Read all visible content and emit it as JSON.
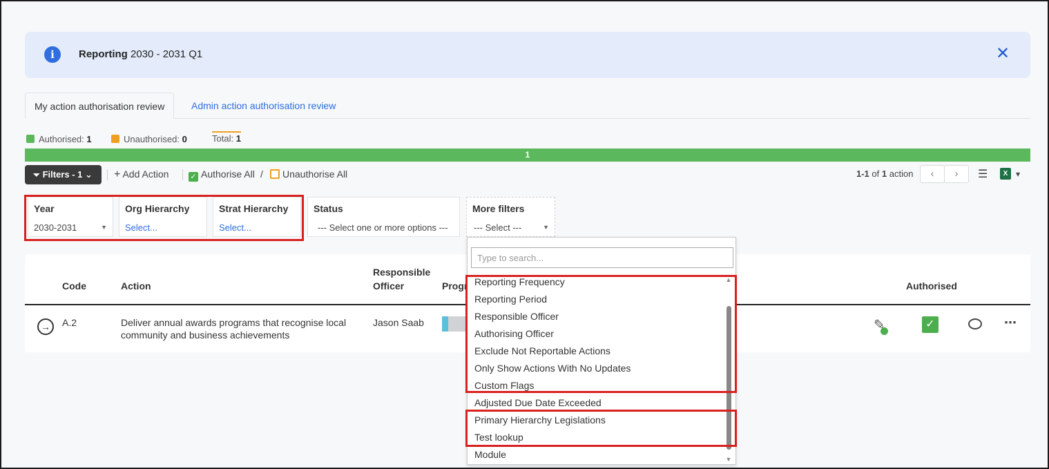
{
  "banner": {
    "title_bold": "Reporting",
    "title_rest": " 2030 - 2031 Q1",
    "info_icon": "i",
    "close_icon": "✕"
  },
  "tabs": [
    {
      "label": "My action authorisation review",
      "active": true
    },
    {
      "label": "Admin action authorisation review",
      "active": false
    }
  ],
  "legend": {
    "authorised_label": "Authorised:",
    "authorised_count": "1",
    "unauthorised_label": "Unauthorised:",
    "unauthorised_count": "0",
    "total_label": "Total:",
    "total_count": "1",
    "colors": {
      "authorised": "#5cb85c",
      "unauthorised": "#f0a020"
    }
  },
  "progress": {
    "label": "1",
    "fraction_authorised": 1.0
  },
  "toolbar": {
    "filters_label": "Filters - 1",
    "filters_caret": "⌄",
    "add_action_label": "Add Action",
    "authorise_all_label": "Authorise All",
    "slash": "/",
    "unauthorise_all_label": "Unauthorise All",
    "pager_range": "1-1",
    "pager_of": "of",
    "pager_total": "1",
    "pager_unit": "action",
    "prev": "‹",
    "next": "›",
    "settings_icon": "sliders-icon",
    "excel_icon": "excel-icon",
    "excel_text": "X",
    "export_caret": "▾"
  },
  "filters": {
    "year": {
      "label": "Year",
      "value": "2030-2031"
    },
    "org": {
      "label": "Org Hierarchy",
      "placeholder": "Select..."
    },
    "strat": {
      "label": "Strat Hierarchy",
      "placeholder": "Select..."
    },
    "status": {
      "label": "Status",
      "placeholder": "--- Select one or more options ---"
    },
    "more": {
      "label": "More filters",
      "placeholder": "--- Select ---"
    }
  },
  "table": {
    "headers": {
      "code": "Code",
      "action": "Action",
      "officer_line1": "Responsible",
      "officer_line2": "Officer",
      "progress": "Progr",
      "authorised": "Authorised"
    },
    "rows": [
      {
        "code": "A.2",
        "action_line1": "Deliver annual awards programs that recognise local",
        "action_line2": "community and business achievements",
        "officer": "Jason Saab",
        "progress_fraction": 0.25,
        "authorised": true
      }
    ]
  },
  "dropdown": {
    "search_placeholder": "Type to search...",
    "options": [
      "Reporting Frequency",
      "Reporting Period",
      "Responsible Officer",
      "Authorising Officer",
      "Exclude Not Reportable Actions",
      "Only Show Actions With No Updates",
      "Custom Flags",
      "Adjusted Due Date Exceeded",
      "Primary Hierarchy Legislations",
      "Test lookup",
      "Module"
    ]
  }
}
